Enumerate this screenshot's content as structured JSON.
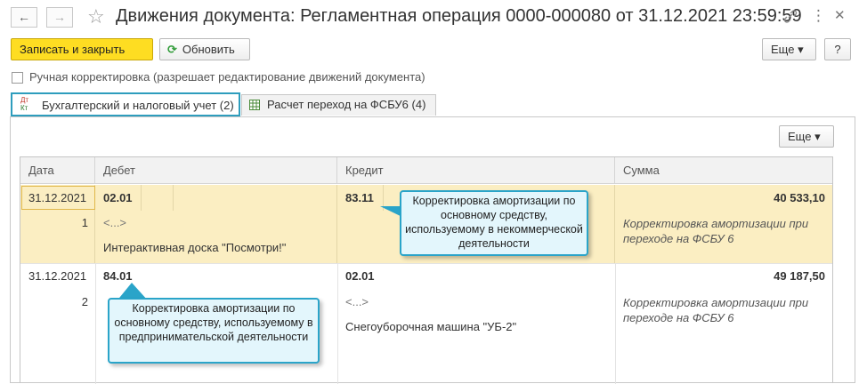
{
  "window": {
    "title": "Движения документа: Регламентная операция 0000-000080 от 31.12.2021 23:59:59",
    "back_icon": "←",
    "forward_icon": "→",
    "star_icon": "☆",
    "link_icon": "🔗",
    "menu_icon": "⋮",
    "close_icon": "✕"
  },
  "toolbar": {
    "save_close_label": "Записать и закрыть",
    "refresh_label": "Обновить",
    "more_label": "Еще ▾",
    "help_label": "?"
  },
  "manual_correction": {
    "label": "Ручная корректировка (разрешает редактирование движений документа)",
    "checked": false
  },
  "tabs": [
    {
      "label": "Бухгалтерский и налоговый учет (2)",
      "active": true,
      "icon": "dt-kt-icon"
    },
    {
      "label": "Расчет переход на ФСБУ6 (4)",
      "active": false,
      "icon": "table-icon"
    }
  ],
  "table_toolbar": {
    "more_label": "Еще ▾"
  },
  "columns": [
    "Дата",
    "Дебет",
    "Кредит",
    "Сумма"
  ],
  "rows": [
    {
      "date": "31.12.2021",
      "num": "1",
      "debit_account": "02.01",
      "debit_sub1": "<...>",
      "debit_sub2": "Интерактивная доска \"Посмотри!\"",
      "credit_account": "83.11",
      "amount": "40 533,10",
      "content": "Корректировка амортизации при переходе на ФСБУ 6"
    },
    {
      "date": "31.12.2021",
      "num": "2",
      "debit_account": "84.01",
      "credit_account": "02.01",
      "credit_sub1": "<...>",
      "credit_sub2": "Снегоуборочная машина \"УБ-2\"",
      "amount": "49 187,50",
      "content": "Корректировка амортизации при переходе на ФСБУ 6"
    }
  ],
  "callouts": {
    "top": "Корректировка амортизации по основному средству, используемому в некоммерческой деятельности",
    "bottom": "Корректировка амортизации по основному средству, используемому в предпринимательской деятельности"
  },
  "colors": {
    "accent": "#2e9dbd",
    "primary_button": "#fedd22",
    "selected_row": "#fbeec2",
    "callout_border": "#2aa4c9",
    "callout_bg": "#e3f6fc"
  }
}
